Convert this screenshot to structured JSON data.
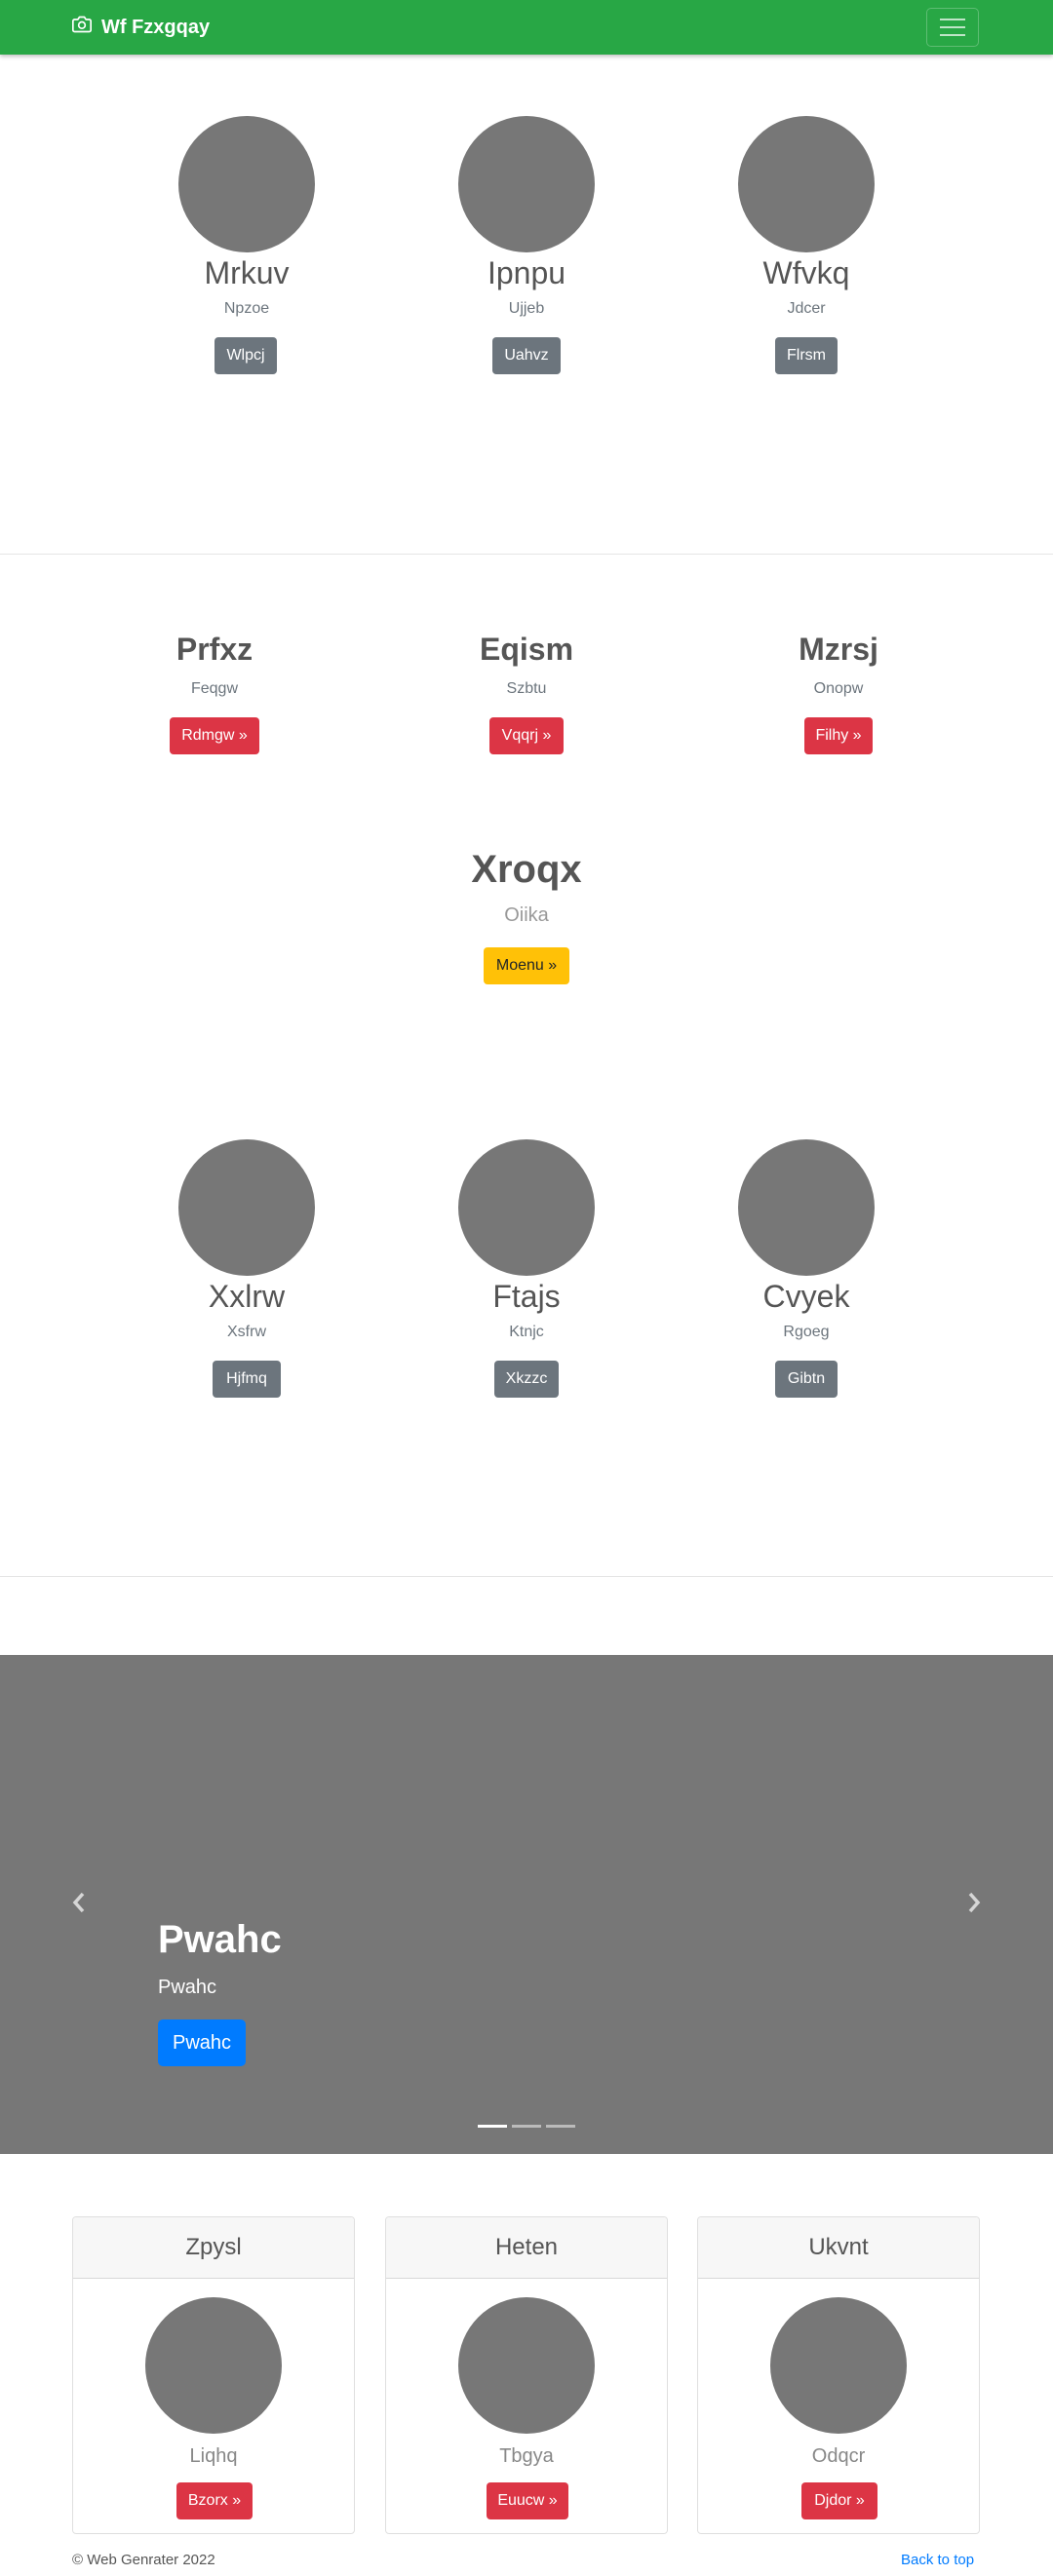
{
  "navbar": {
    "brand": "Wf Fzxgqay",
    "camera_icon": "camera-icon",
    "toggler_icon": "hamburger-icon",
    "color": "#28a745"
  },
  "section1": {
    "items": [
      {
        "name": "Mrkuv",
        "sub": "Npzoe",
        "button": "Wlpcj"
      },
      {
        "name": "Ipnpu",
        "sub": "Ujjeb",
        "button": "Uahvz"
      },
      {
        "name": "Wfvkq",
        "sub": "Jdcer",
        "button": "Flrsm"
      }
    ]
  },
  "section2": {
    "items": [
      {
        "title": "Prfxz",
        "sub": "Feqgw",
        "button": "Rdmgw »"
      },
      {
        "title": "Eqism",
        "sub": "Szbtu",
        "button": "Vqqrj »"
      },
      {
        "title": "Mzrsj",
        "sub": "Onopw",
        "button": "Filhy »"
      }
    ],
    "feature": {
      "title": "Xroqx",
      "sub": "Oiika",
      "button": "Moenu »"
    }
  },
  "section3": {
    "items": [
      {
        "name": "Xxlrw",
        "sub": "Xsfrw",
        "button": "Hjfmq"
      },
      {
        "name": "Ftajs",
        "sub": "Ktnjc",
        "button": "Xkzzc"
      },
      {
        "name": "Cvyek",
        "sub": "Rgoeg",
        "button": "Gibtn"
      }
    ]
  },
  "carousel": {
    "title": "Pwahc",
    "subtitle": "Pwahc",
    "button": "Pwahc",
    "prev_icon": "chevron-left-icon",
    "next_icon": "chevron-right-icon",
    "active_slide": 1,
    "slide_count": 3
  },
  "cards": [
    {
      "header": "Zpysl",
      "text": "Liqhq",
      "button": "Bzorx »"
    },
    {
      "header": "Heten",
      "text": "Tbgya",
      "button": "Euucw »"
    },
    {
      "header": "Ukvnt",
      "text": "Odqcr",
      "button": "Djdor »"
    }
  ],
  "footer": {
    "copyright": "© Web Genrater 2022",
    "back_to_top": "Back to top"
  }
}
